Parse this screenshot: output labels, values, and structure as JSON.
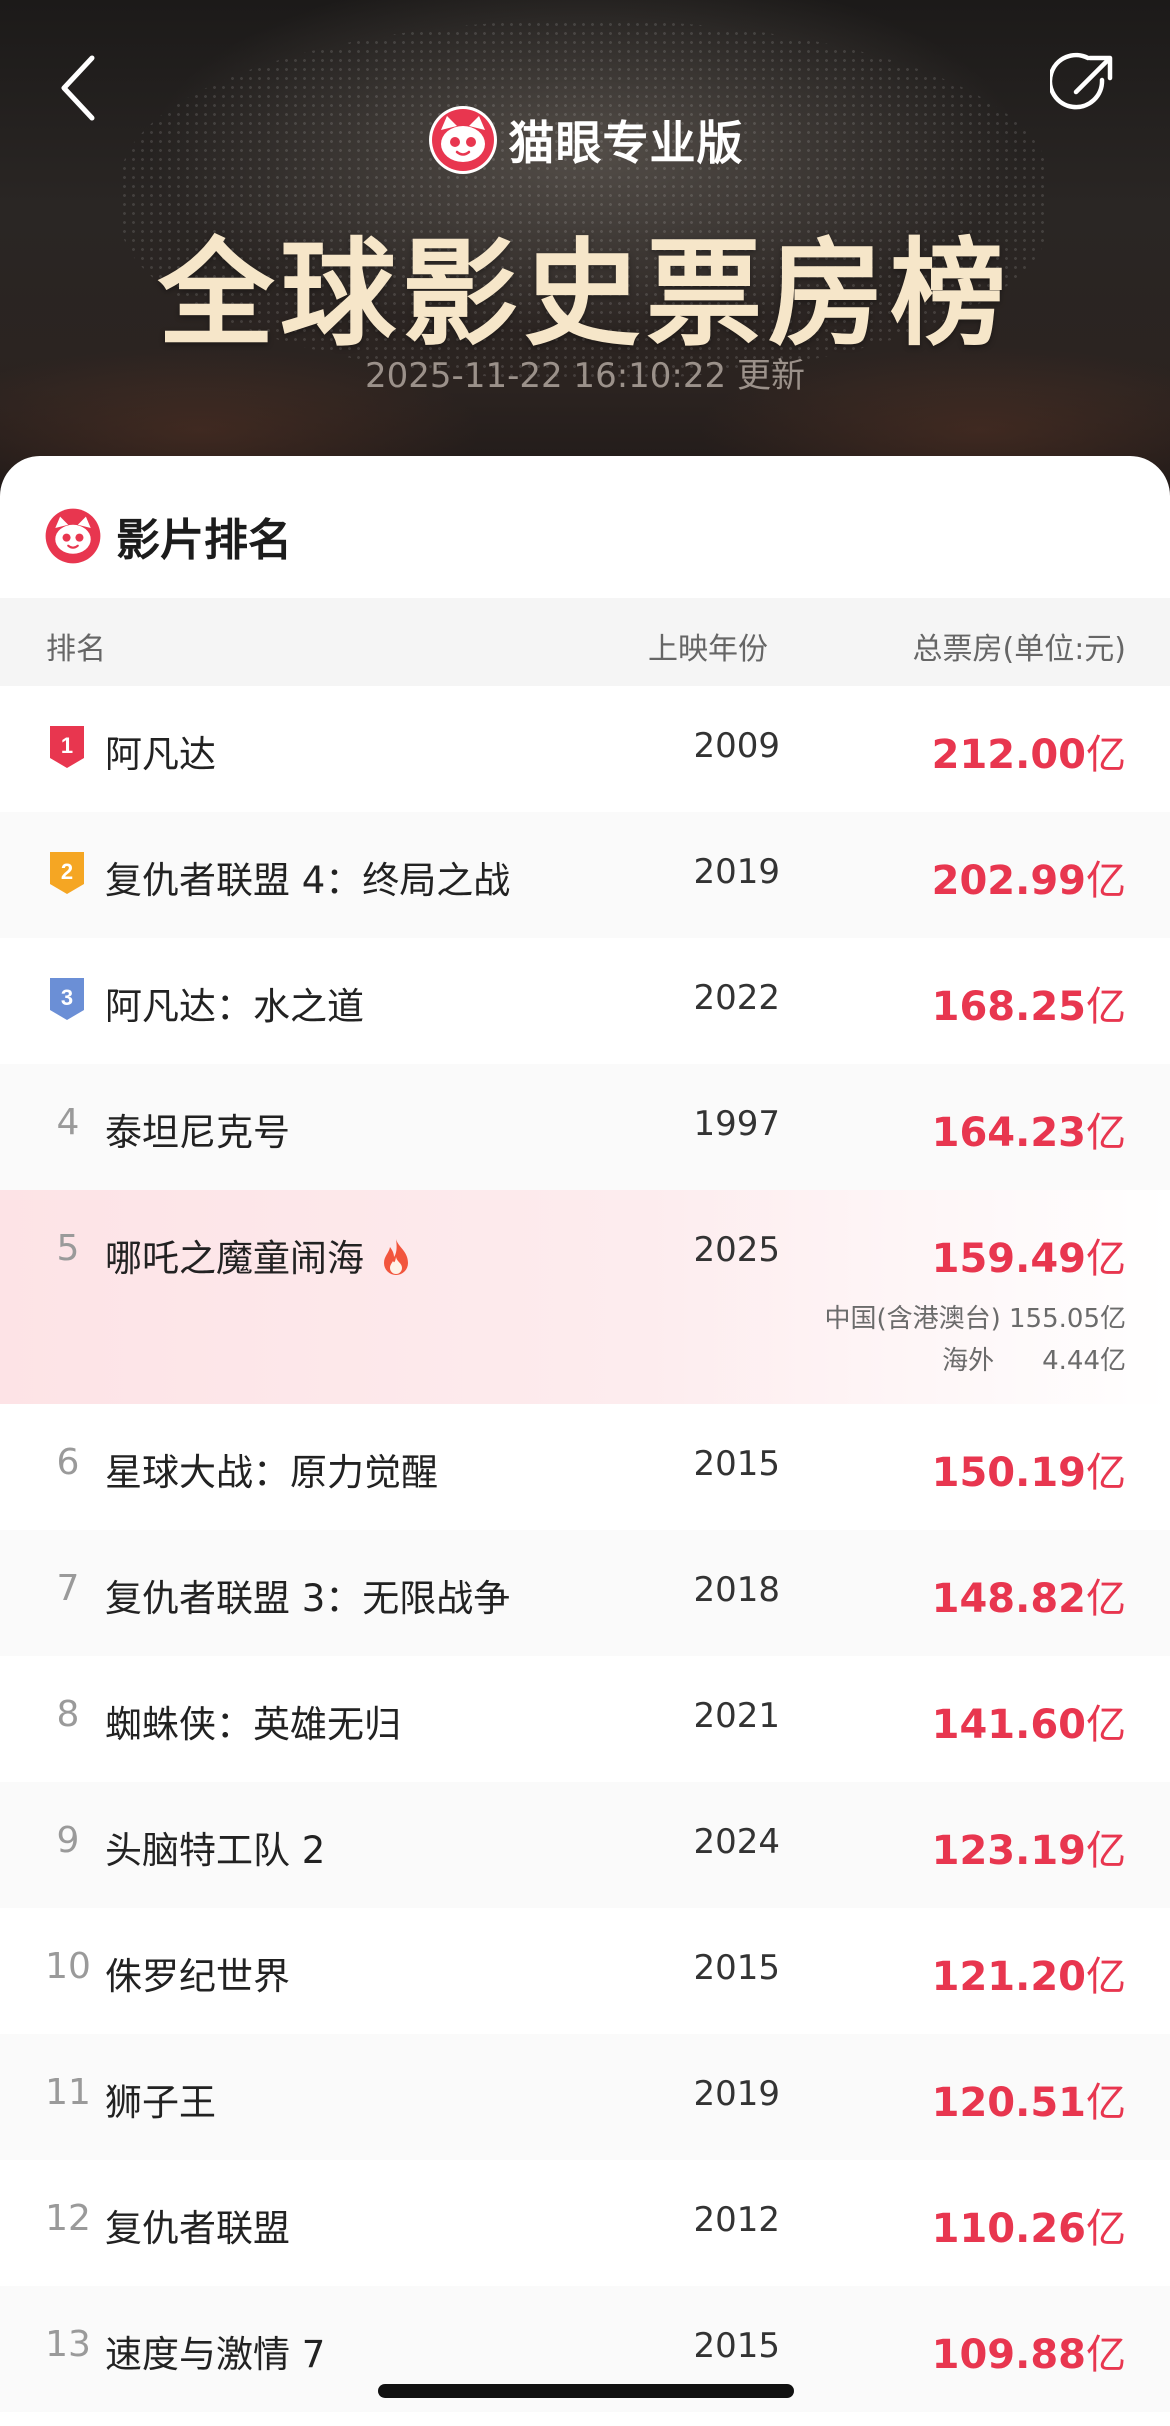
{
  "header": {
    "brand_name": "猫眼专业版",
    "title": "全球影史票房榜",
    "update_time": "2025-11-22 16:10:22",
    "update_suffix": "更新"
  },
  "card": {
    "title": "影片排名",
    "columns": {
      "rank": "排名",
      "year": "上映年份",
      "gross": "总票房(单位:元)"
    }
  },
  "movies": [
    {
      "rank": "1",
      "name": "阿凡达",
      "year": "2009",
      "gross": "212.00",
      "unit": "亿"
    },
    {
      "rank": "2",
      "name": "复仇者联盟 4：终局之战",
      "year": "2019",
      "gross": "202.99",
      "unit": "亿"
    },
    {
      "rank": "3",
      "name": "阿凡达：水之道",
      "year": "2022",
      "gross": "168.25",
      "unit": "亿"
    },
    {
      "rank": "4",
      "name": "泰坦尼克号",
      "year": "1997",
      "gross": "164.23",
      "unit": "亿"
    },
    {
      "rank": "5",
      "name": "哪吒之魔童闹海",
      "year": "2025",
      "gross": "159.49",
      "unit": "亿",
      "china_label": "中国(含港澳台)",
      "china_gross": "155.05亿",
      "overseas_label": "海外",
      "overseas_gross": "4.44亿"
    },
    {
      "rank": "6",
      "name": "星球大战：原力觉醒",
      "year": "2015",
      "gross": "150.19",
      "unit": "亿"
    },
    {
      "rank": "7",
      "name": "复仇者联盟 3：无限战争",
      "year": "2018",
      "gross": "148.82",
      "unit": "亿"
    },
    {
      "rank": "8",
      "name": "蜘蛛侠：英雄无归",
      "year": "2021",
      "gross": "141.60",
      "unit": "亿"
    },
    {
      "rank": "9",
      "name": "头脑特工队 2",
      "year": "2024",
      "gross": "123.19",
      "unit": "亿"
    },
    {
      "rank": "10",
      "name": "侏罗纪世界",
      "year": "2015",
      "gross": "121.20",
      "unit": "亿"
    },
    {
      "rank": "11",
      "name": "狮子王",
      "year": "2019",
      "gross": "120.51",
      "unit": "亿"
    },
    {
      "rank": "12",
      "name": "复仇者联盟",
      "year": "2012",
      "gross": "110.26",
      "unit": "亿"
    },
    {
      "rank": "13",
      "name": "速度与激情 7",
      "year": "2015",
      "gross": "109.88",
      "unit": "亿"
    }
  ],
  "colors": {
    "accent": "#e8364f",
    "badge_gold": "#f5a623",
    "badge_silver": "#f5a623",
    "badge_bronze": "#6b8fd6",
    "title_cream": "#f6e6c9"
  },
  "icons": {
    "back": "chevron-left-icon",
    "share": "share-icon",
    "logo": "maoyan-cat-logo-icon",
    "hot": "fire-icon"
  }
}
